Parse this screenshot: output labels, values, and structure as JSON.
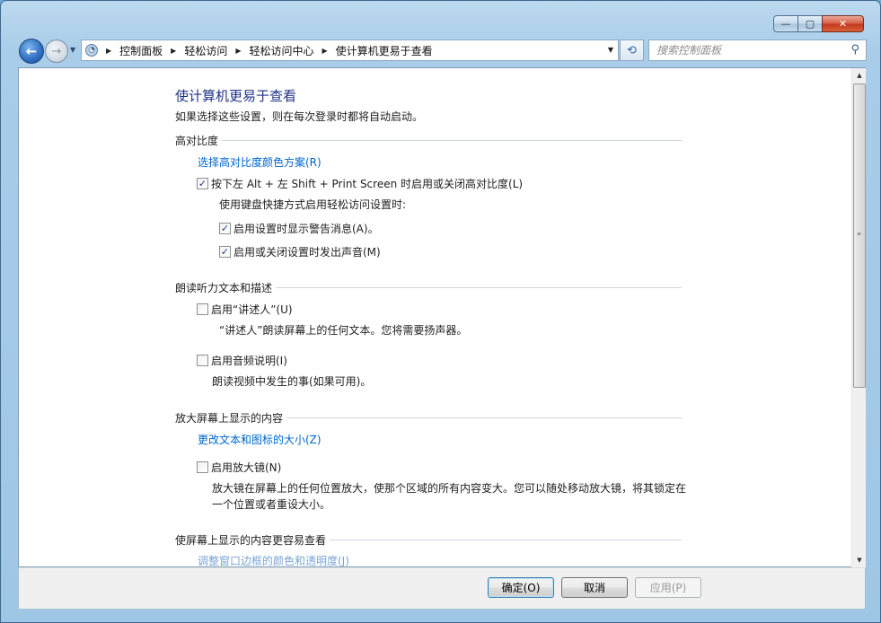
{
  "window": {
    "caption_buttons": {
      "minimize": "—",
      "maximize": "▢",
      "close": "✕"
    }
  },
  "nav": {
    "back": "←",
    "forward": "→",
    "dropdown": "▼",
    "breadcrumb": [
      "控制面板",
      "轻松访问",
      "轻松访问中心",
      "使计算机更易于查看"
    ],
    "breadcrumb_sep": "▶",
    "address_dropdown": "▼",
    "refresh": "⟲",
    "search_placeholder": "搜索控制面板",
    "search_icon": "⚲"
  },
  "page": {
    "title": "使计算机更易于查看",
    "subtitle": "如果选择这些设置，则在每次登录时都将自动启动。"
  },
  "sections": {
    "high_contrast": {
      "heading": "高对比度",
      "link": "选择高对比度颜色方案(R)",
      "toggle_label": "按下左 Alt + 左 Shift + Print Screen 时启用或关闭高对比度(L)",
      "toggle_checked": true,
      "shortcut_note": "使用键盘快捷方式启用轻松访问设置时:",
      "warn_label": "启用设置时显示警告消息(A)。",
      "warn_checked": true,
      "sound_label": "启用或关闭设置时发出声音(M)",
      "sound_checked": true
    },
    "narrator": {
      "heading": "朗读听力文本和描述",
      "narrator_label": "启用“讲述人”(U)",
      "narrator_checked": false,
      "narrator_desc": "“讲述人”朗读屏幕上的任何文本。您将需要扬声器。",
      "audio_desc_label": "启用音频说明(I)",
      "audio_desc_checked": false,
      "audio_desc_desc": "朗读视频中发生的事(如果可用)。"
    },
    "magnify": {
      "heading": "放大屏幕上显示的内容",
      "link": "更改文本和图标的大小(Z)",
      "magnifier_label": "启用放大镜(N)",
      "magnifier_checked": false,
      "magnifier_desc_1": "放大镜在屏幕上的任何位置放大，使那个区域的所有内容变大。您可以随处移动放大镜，将其锁定在",
      "magnifier_desc_2": "一个位置或者重设大小。"
    },
    "easier": {
      "heading": "使屏幕上显示的内容更容易查看",
      "link": "调整窗口边框的颜色和透明度(J)"
    }
  },
  "buttons": {
    "ok": "确定(O)",
    "cancel": "取消",
    "apply": "应用(P)"
  },
  "scrollbar": {
    "up": "▲",
    "down": "▼",
    "grip": "≡"
  },
  "checkmark": "✓"
}
